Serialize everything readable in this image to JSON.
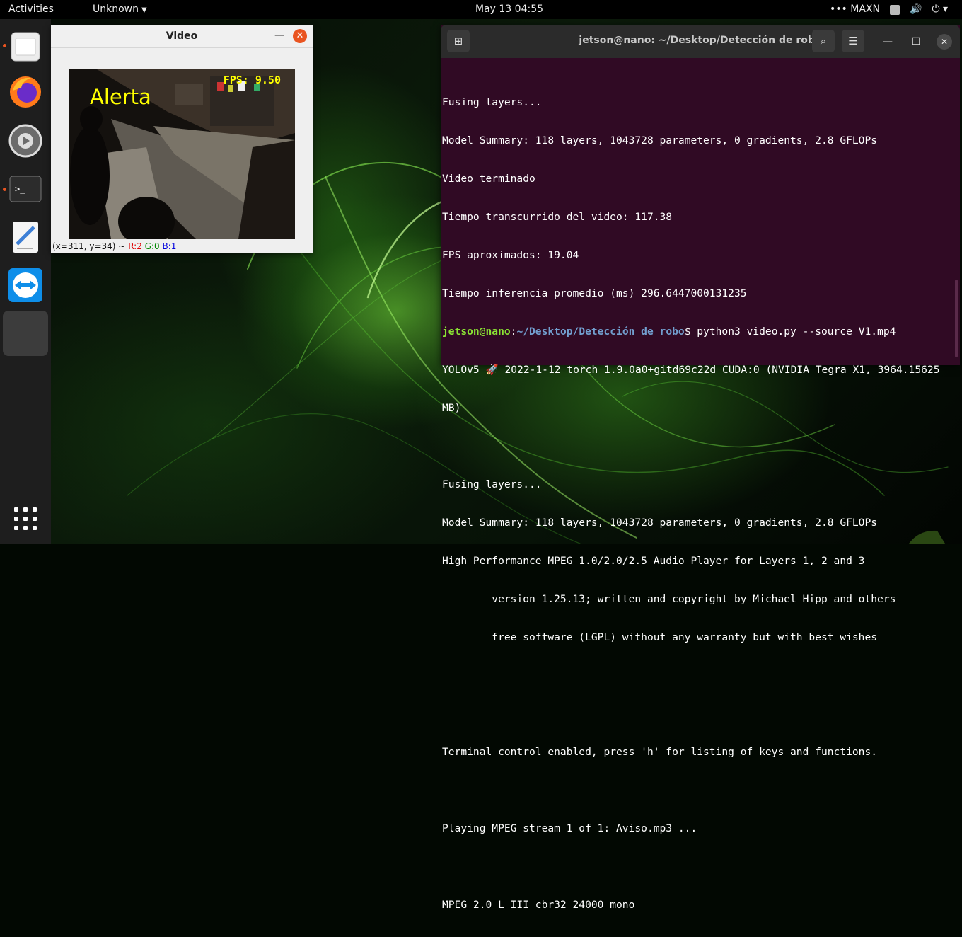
{
  "topbar": {
    "activities": "Activities",
    "app_menu": "Unknown",
    "clock": "May 13  04:55",
    "power_mode": "MAXN",
    "icons": [
      "dots-icon",
      "clipboard-icon",
      "volume-icon",
      "power-icon",
      "chevron-down-icon"
    ]
  },
  "dock": {
    "items": [
      "files",
      "firefox",
      "settings",
      "terminal",
      "text-editor",
      "teamviewer",
      "running-app"
    ],
    "show_apps": "apps-grid-icon"
  },
  "video_window": {
    "title": "Video",
    "overlay_fps": "FPS: 9.50",
    "overlay_alert": "Alerta",
    "status_coords": "(x=311, y=34) ~",
    "status_r": "R:2",
    "status_g": "G:0",
    "status_b": "B:1"
  },
  "terminal": {
    "title": "jetson@nano: ~/Desktop/Detección de robo",
    "lines": [
      "Fusing layers...",
      "Model Summary: 118 layers, 1043728 parameters, 0 gradients, 2.8 GFLOPs",
      "Video terminado",
      "Tiempo transcurrido del video: 117.38",
      "FPS aproximados: 19.04",
      "Tiempo inferencia promedio (ms) 296.6447000131235"
    ],
    "prompt_user": "jetson@nano",
    "prompt_sep": ":",
    "prompt_path": "~/Desktop/Detección de robo",
    "prompt_cmd": "$ python3 video.py --source V1.mp4",
    "lines2": [
      "YOLOv5 🚀 2022-1-12 torch 1.9.0a0+gitd69c22d CUDA:0 (NVIDIA Tegra X1, 3964.15625",
      "MB)",
      "",
      "Fusing layers...",
      "Model Summary: 118 layers, 1043728 parameters, 0 gradients, 2.8 GFLOPs",
      "High Performance MPEG 1.0/2.0/2.5 Audio Player for Layers 1, 2 and 3",
      "        version 1.25.13; written and copyright by Michael Hipp and others",
      "        free software (LGPL) without any warranty but with best wishes",
      "",
      "",
      "Terminal control enabled, press 'h' for listing of keys and functions.",
      "",
      "Playing MPEG stream 1 of 1: Aviso.mp3 ...",
      "",
      "MPEG 2.0 L III cbr32 24000 mono"
    ]
  },
  "colors": {
    "terminal_bg": "#300a24",
    "accent": "#e95420",
    "prompt_user": "#8ae234",
    "prompt_path": "#729fcf",
    "overlay_text": "#ffff00"
  }
}
